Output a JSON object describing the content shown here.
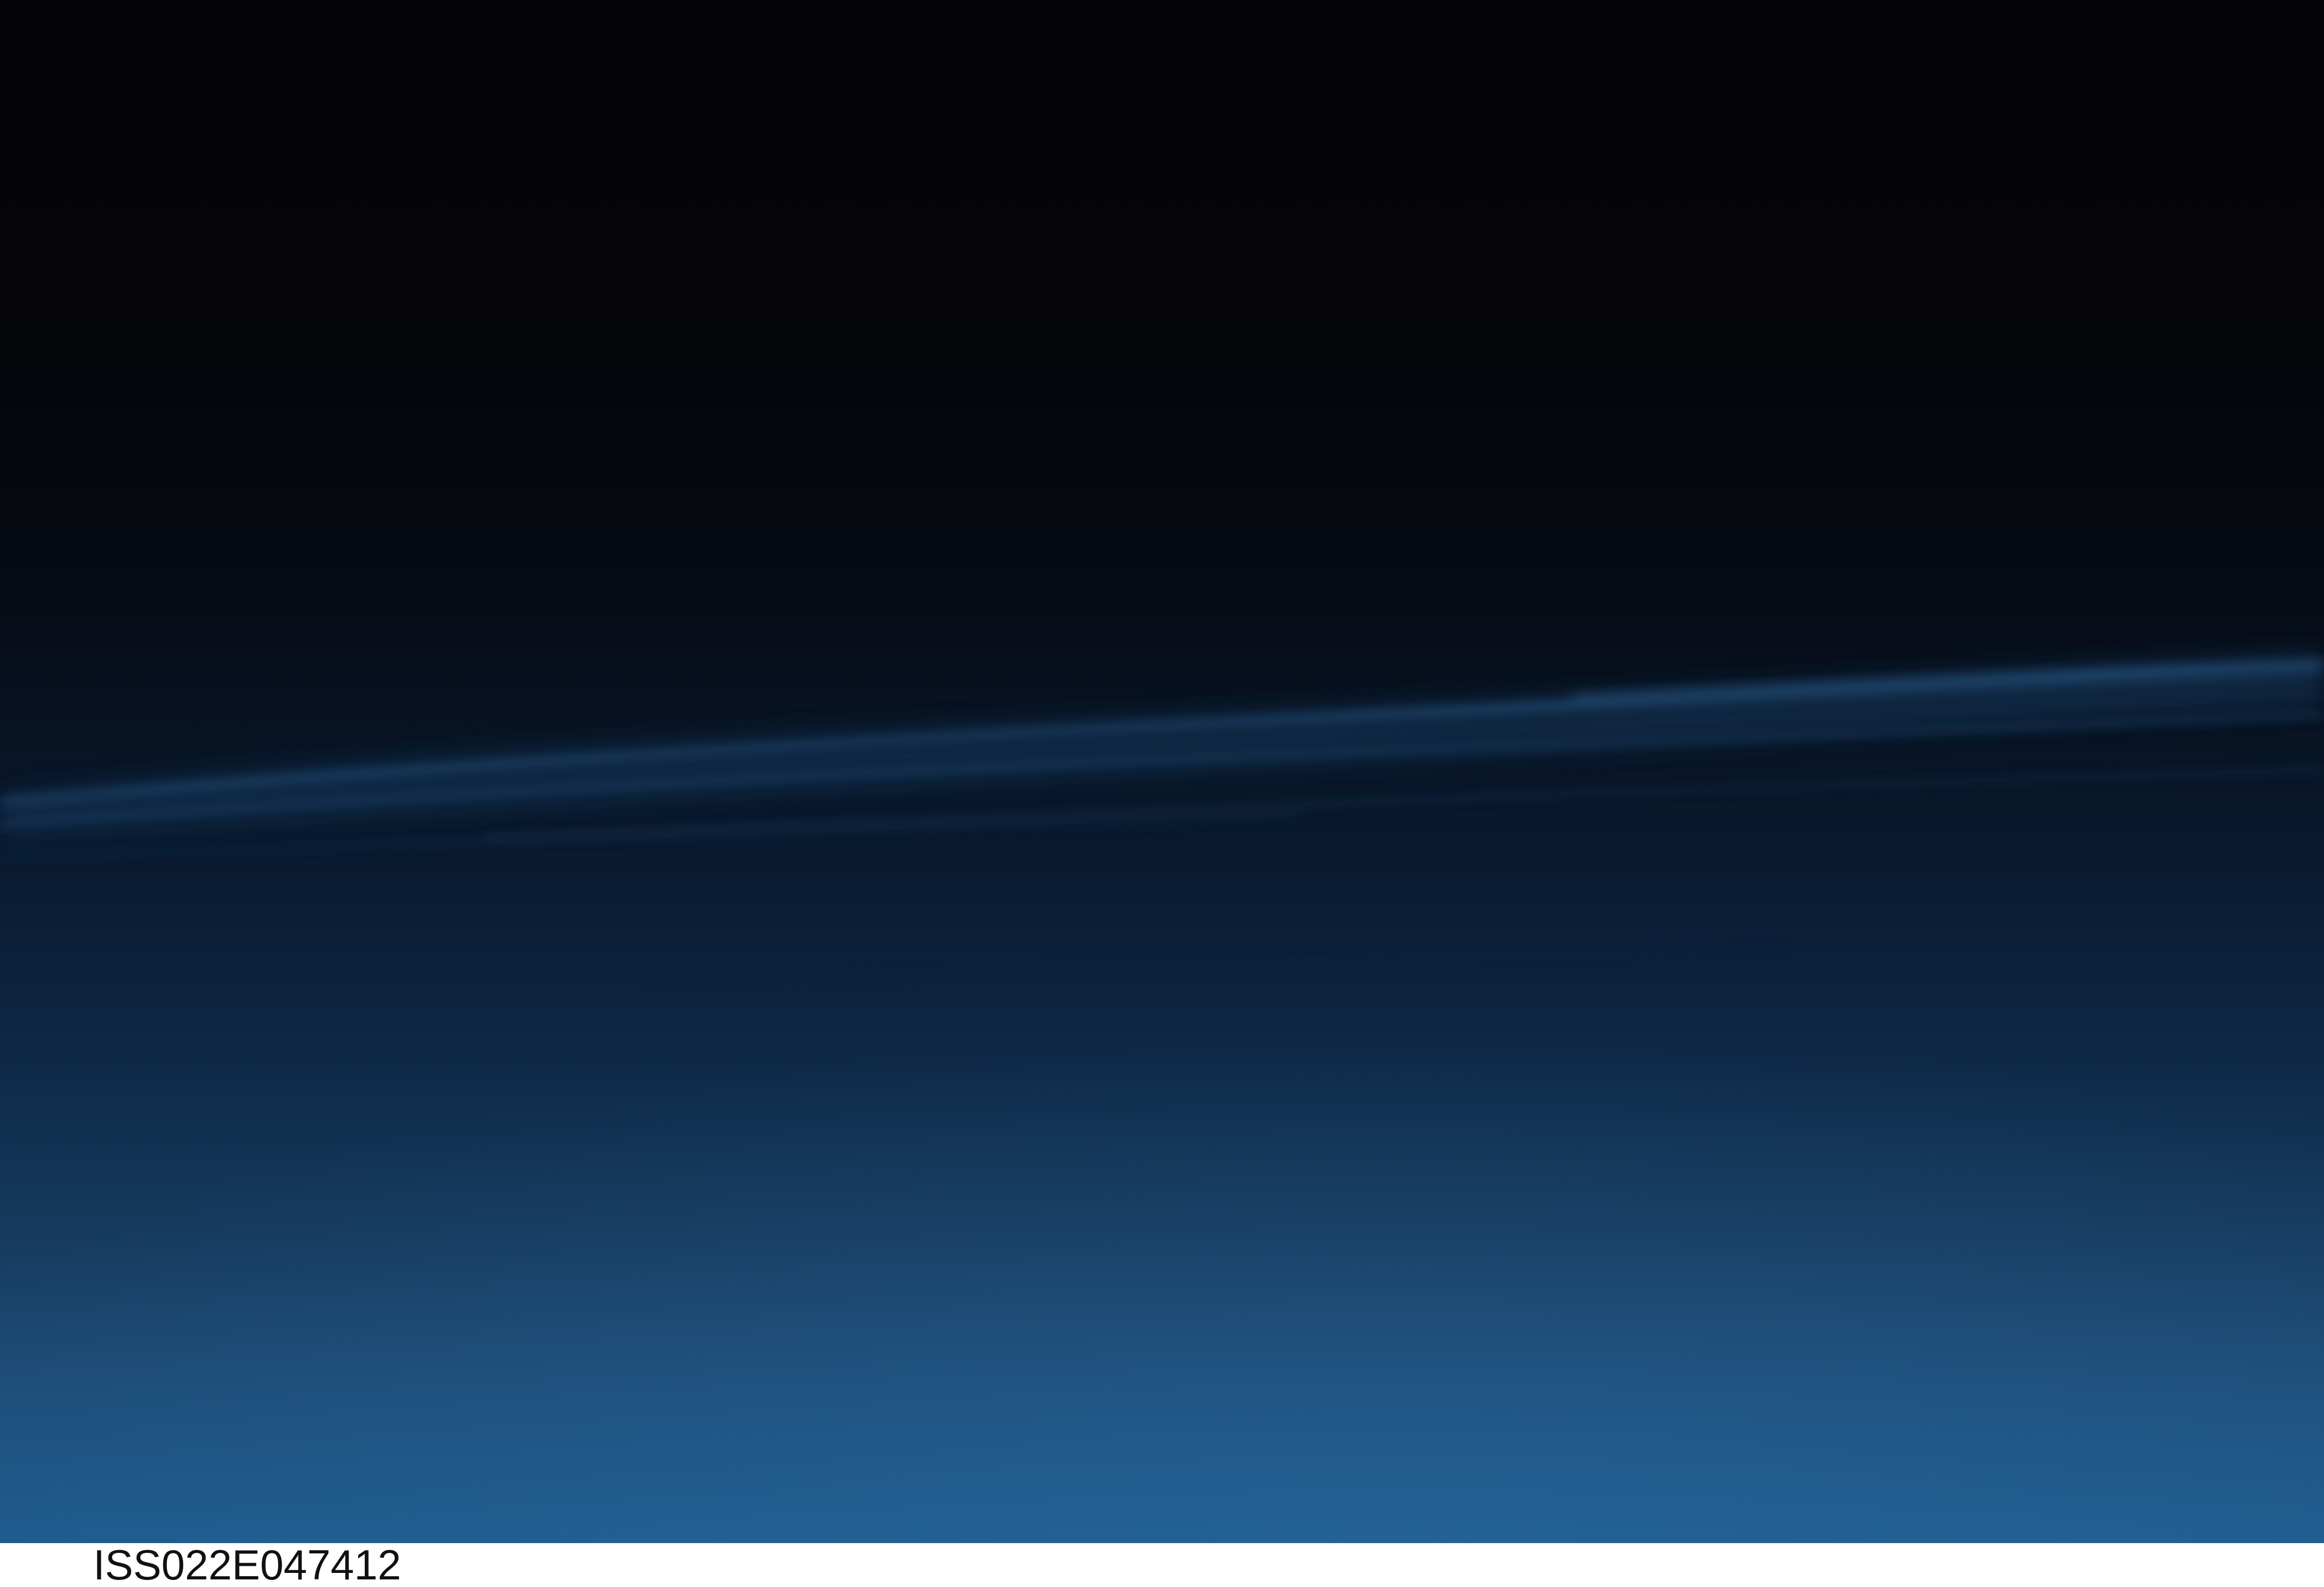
{
  "caption": {
    "text": "ISS022E047412"
  },
  "colors": {
    "sky_top": "#040306",
    "sky_mid": "#0a1c33",
    "sky_bottom": "#1f5b8d",
    "cloud_highlight": "#2a5a88",
    "caption_text": "#111111"
  }
}
